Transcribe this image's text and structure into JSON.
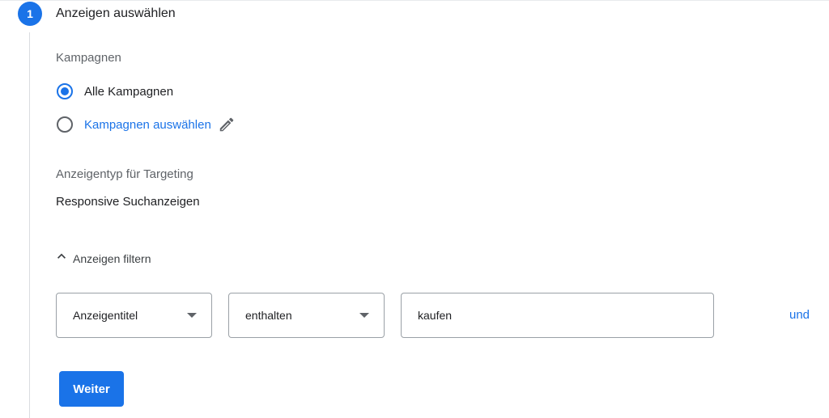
{
  "step": {
    "number": "1",
    "title": "Anzeigen auswählen"
  },
  "campaigns": {
    "label": "Kampagnen",
    "options": [
      {
        "label": "Alle Kampagnen",
        "selected": true
      },
      {
        "label": "Kampagnen auswählen",
        "selected": false
      }
    ]
  },
  "ad_type": {
    "label": "Anzeigentyp für Targeting",
    "value": "Responsive Suchanzeigen"
  },
  "filter": {
    "toggle_label": "Anzeigen filtern",
    "field_select": "Anzeigentitel",
    "operator_select": "enthalten",
    "value_input": "kaufen",
    "and_link": "und"
  },
  "actions": {
    "continue_label": "Weiter"
  },
  "colors": {
    "accent": "#1a73e8",
    "rail": "#dadce0"
  }
}
